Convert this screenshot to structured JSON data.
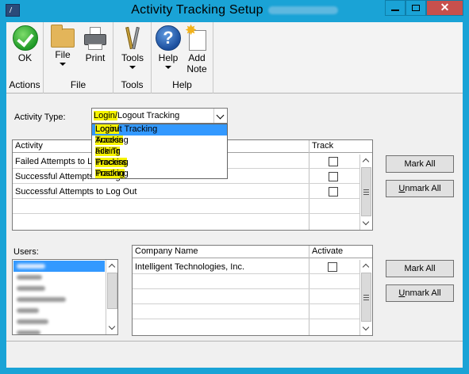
{
  "window": {
    "title": "Activity Tracking Setup",
    "app_icon": "dynamics-gp-icon",
    "minimize": "minimize-icon",
    "maximize": "maximize-icon",
    "close_label": "✕"
  },
  "ribbon": {
    "groups": [
      {
        "label": "Actions",
        "buttons": [
          {
            "label": "OK",
            "icon": "ok-checkmark-icon"
          }
        ]
      },
      {
        "label": "File",
        "buttons": [
          {
            "label": "File",
            "icon": "folder-icon",
            "has_dropdown": true
          },
          {
            "label": "Print",
            "icon": "printer-icon"
          }
        ]
      },
      {
        "label": "Tools",
        "buttons": [
          {
            "label": "Tools",
            "icon": "tools-icon",
            "has_dropdown": true
          }
        ]
      },
      {
        "label": "Help",
        "buttons": [
          {
            "label": "Help",
            "icon": "help-icon",
            "has_dropdown": true
          },
          {
            "label": "Add\nNote",
            "icon": "add-note-icon"
          }
        ]
      }
    ]
  },
  "activity": {
    "label": "Activity Type:",
    "selected_prefix": "Login/",
    "selected_rest": "Logout Tracking",
    "options": [
      {
        "hl": "Login/",
        "rest": "Logout Tracking"
      },
      {
        "hl": "Access",
        "rest": " Tracking"
      },
      {
        "hl": "File Tr",
        "rest": "acking"
      },
      {
        "hl": "Process",
        "rest": " Tracking"
      },
      {
        "hl": "Posting",
        "rest": " Tracking"
      }
    ]
  },
  "activity_grid": {
    "headers": {
      "activity": "Activity",
      "track": "Track"
    },
    "rows": [
      {
        "activity": "Failed Attempts to Log In",
        "track": false
      },
      {
        "activity": "Successful Attempts to Log In",
        "track": false
      },
      {
        "activity": "Successful Attempts to Log Out",
        "track": false
      },
      {
        "activity": "",
        "track": null
      },
      {
        "activity": "",
        "track": null
      }
    ]
  },
  "buttons": {
    "mark_all": "Mark All",
    "unmark_all_u": "U",
    "unmark_all_rest": "nmark All",
    "mark_all_2": "Mark All",
    "unmark_all_2_u": "U",
    "unmark_all_2_rest": "nmark All"
  },
  "users": {
    "label": "Users:",
    "items_blurred_count": 7
  },
  "company_grid": {
    "headers": {
      "company": "Company Name",
      "activate": "Activate"
    },
    "rows": [
      {
        "company": "Intelligent Technologies, Inc.",
        "activate": false
      },
      {
        "company": "",
        "activate": null
      },
      {
        "company": "",
        "activate": null
      },
      {
        "company": "",
        "activate": null
      }
    ]
  }
}
